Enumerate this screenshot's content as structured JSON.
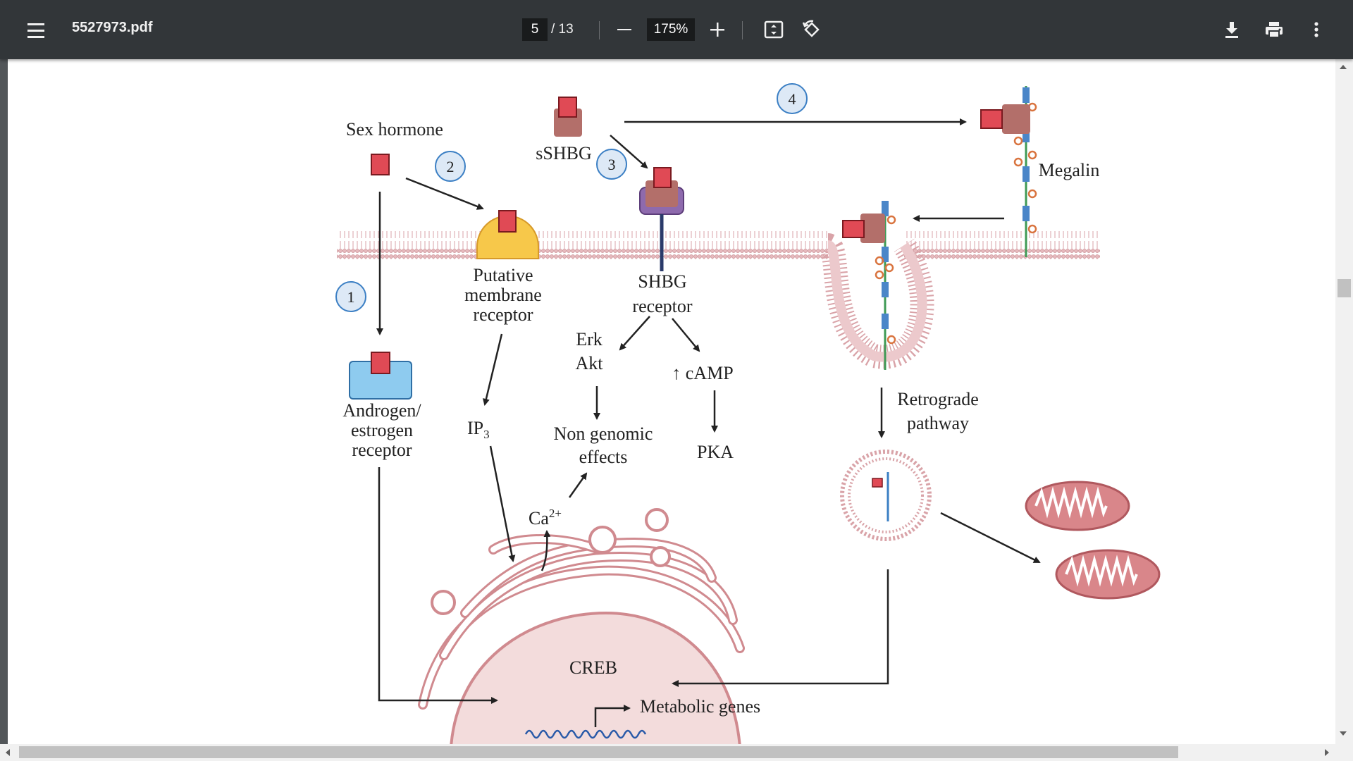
{
  "toolbar": {
    "menu_icon": "hamburger-icon",
    "file_name": "5527973.pdf",
    "current_page": "5",
    "page_total": "/ 13",
    "zoom_level": "175%",
    "zoom_out_icon": "minus-icon",
    "zoom_in_icon": "plus-icon",
    "fit_icon": "fit-to-page-icon",
    "rotate_icon": "rotate-icon",
    "download_icon": "download-icon",
    "print_icon": "print-icon",
    "more_icon": "more-vertical-icon"
  },
  "figure": {
    "sex_hormone": "Sex hormone",
    "sshbg": "sSHBG",
    "megalin": "Megalin",
    "putative_1": "Putative",
    "putative_2": "membrane",
    "putative_3": "receptor",
    "shbg_1": "SHBG",
    "shbg_2": "receptor",
    "erk": "Erk",
    "akt": "Akt",
    "camp": "↑ cAMP",
    "pka": "PKA",
    "non_genomic_1": "Non genomic",
    "non_genomic_2": "effects",
    "androgen_1": "Androgen/",
    "androgen_2": "estrogen",
    "androgen_3": "receptor",
    "ip": "IP",
    "ip_sub": "3",
    "ca": "Ca",
    "ca_sup": "2+",
    "retrograde_1": "Retrograde",
    "retrograde_2": "pathway",
    "creb": "CREB",
    "metabolic_genes": "Metabolic genes",
    "step_1": "1",
    "step_2": "2",
    "step_3": "3",
    "step_4": "4"
  },
  "colors": {
    "toolbar_bg": "#323639",
    "hormone_red": "#e04a55",
    "membrane": "#d9a3a8",
    "receptor_yellow": "#f7c84a",
    "receptor_blue": "#8ecbef",
    "shbg_purple": "#8e6aad",
    "sshbg_brown": "#b36f6a",
    "step_circle": "#dde9f6"
  }
}
